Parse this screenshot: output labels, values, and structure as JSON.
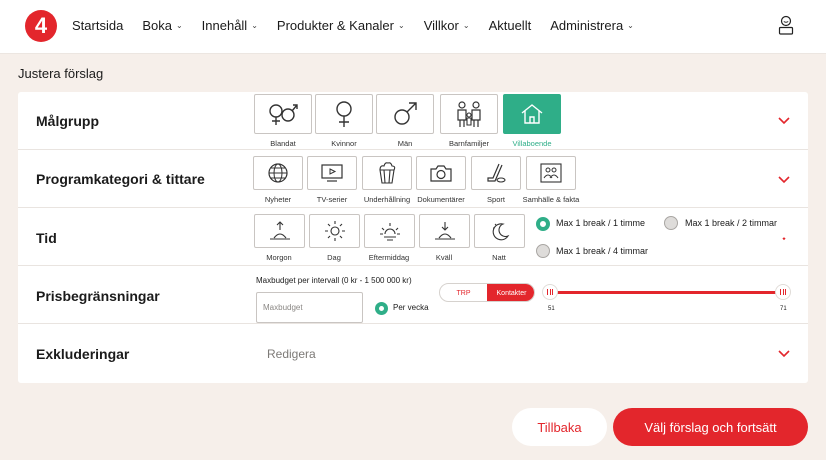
{
  "nav": {
    "logo_text": "4",
    "items": [
      {
        "label": "Startsida",
        "has_dropdown": false
      },
      {
        "label": "Boka",
        "has_dropdown": true
      },
      {
        "label": "Innehåll",
        "has_dropdown": true
      },
      {
        "label": "Produkter & Kanaler",
        "has_dropdown": true
      },
      {
        "label": "Villkor",
        "has_dropdown": true
      },
      {
        "label": "Aktuellt",
        "has_dropdown": false
      },
      {
        "label": "Administrera",
        "has_dropdown": true
      }
    ],
    "user_icon": "user-icon"
  },
  "page_title": "Justera förslag",
  "rows": [
    {
      "label": "Målgrupp"
    },
    {
      "label": "Programkategori & tittare"
    },
    {
      "label": "Tid"
    },
    {
      "label": "Prisbegränsningar"
    },
    {
      "label": "Exkluderingar"
    }
  ],
  "target_groups": [
    {
      "label": "Blandat",
      "icon": "mixed-gender-icon",
      "selected": false
    },
    {
      "label": "Kvinnor",
      "icon": "female-icon",
      "selected": false
    },
    {
      "label": "Män",
      "icon": "male-icon",
      "selected": false
    },
    {
      "label": "Barnfamiljer",
      "icon": "family-icon",
      "selected": false
    },
    {
      "label": "Villaboende",
      "icon": "house-icon",
      "selected": true
    }
  ],
  "categories": [
    {
      "label": "Nyheter",
      "icon": "globe-icon"
    },
    {
      "label": "TV-serier",
      "icon": "tv-icon"
    },
    {
      "label": "Underhållning",
      "icon": "popcorn-icon"
    },
    {
      "label": "Dokumentärer",
      "icon": "camera-icon"
    },
    {
      "label": "Sport",
      "icon": "hockey-icon"
    },
    {
      "label": "Samhälle & fakta",
      "icon": "people-picture-icon"
    }
  ],
  "times": [
    {
      "label": "Morgon",
      "icon": "sunrise-icon"
    },
    {
      "label": "Dag",
      "icon": "sun-icon"
    },
    {
      "label": "Eftermiddag",
      "icon": "afternoon-icon"
    },
    {
      "label": "Kväll",
      "icon": "sunset-icon"
    },
    {
      "label": "Natt",
      "icon": "moon-icon"
    }
  ],
  "break_options": [
    {
      "label": "Max 1 break / 1 timme",
      "selected": true
    },
    {
      "label": "Max 1 break / 2 timmar",
      "selected": false
    },
    {
      "label": "Max 1 break / 4 timmar",
      "selected": false
    }
  ],
  "price": {
    "maxbudget_label": "Maxbudget per intervall (0 kr - 1 500 000 kr)",
    "maxbudget_placeholder": "Maxbudget",
    "maxbudget_value": "",
    "per_week_label": "Per vecka",
    "per_week_selected": true,
    "toggle_options": [
      "TRP",
      "Kontakter"
    ],
    "toggle_selected": "Kontakter",
    "slider_min_label": "51",
    "slider_max_label": "71"
  },
  "exclusions": {
    "edit_label": "Redigera"
  },
  "buttons": {
    "back": "Tillbaka",
    "next": "Välj förslag och fortsätt"
  },
  "colors": {
    "brand_red": "#e3262c",
    "selected_green": "#2fae88",
    "page_bg": "#f6efea"
  }
}
